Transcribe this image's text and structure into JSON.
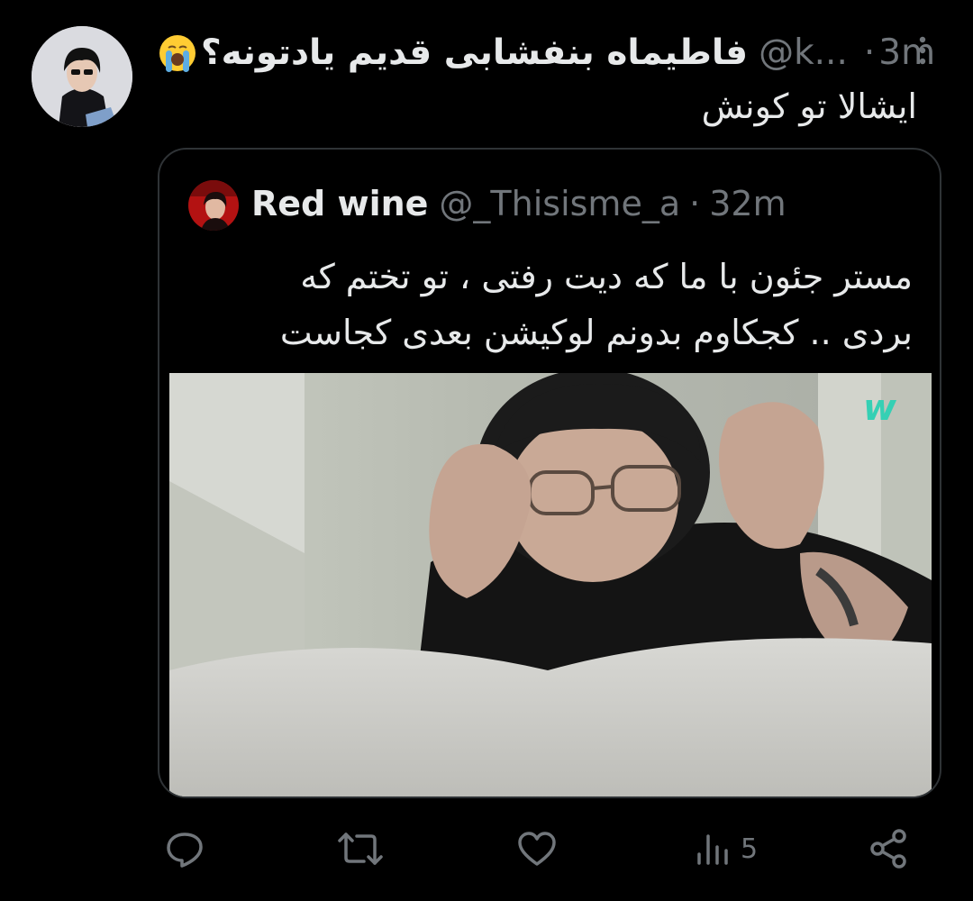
{
  "tweet": {
    "display_name": "فاطیماه بنفشابی قدیم یادتونه؟",
    "handle": "@k...",
    "separator": "·",
    "time": "3m",
    "text": "ایشالا تو کونش",
    "emoji": "crying-face-emoji"
  },
  "quote": {
    "name": "Red wine",
    "handle": "@_Thisisme_a",
    "separator": "·",
    "time": "32m",
    "text_line_1": "مستر جئون با ما که دیت رفتی ، تو تختم که",
    "text_line_2": "بردی .. کجکاوم بدونم لوکیشن بعدی کجاست",
    "media": "photo-of-person-lying-in-bed-wearing-glasses",
    "media_watermark": "w"
  },
  "actions": {
    "reply_icon": "reply-icon",
    "retweet_icon": "retweet-icon",
    "like_icon": "heart-icon",
    "views_icon": "views-icon",
    "views_count": "5",
    "share_icon": "share-icon"
  },
  "colors": {
    "background": "#000000",
    "text_primary": "#e7e9ea",
    "text_secondary": "#71767b",
    "border": "#2f3336"
  }
}
